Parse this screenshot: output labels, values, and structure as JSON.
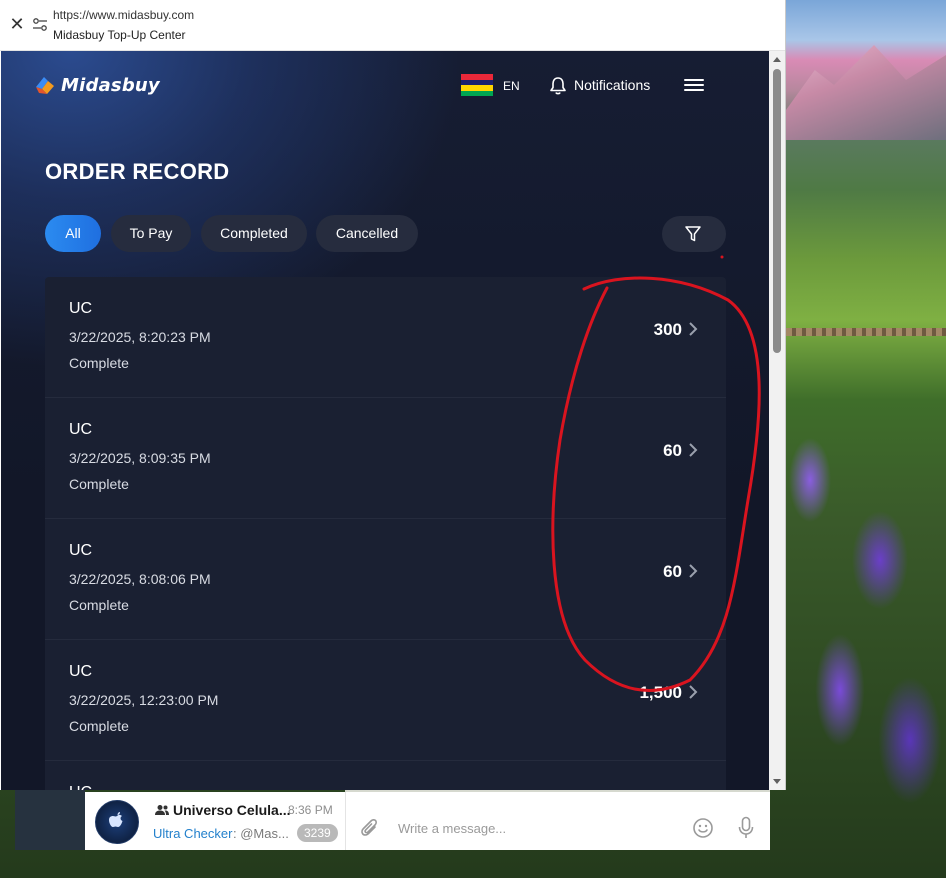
{
  "browser": {
    "url": "https://www.midasbuy.com",
    "title": "Midasbuy Top-Up Center"
  },
  "header": {
    "logo_text": "Midasbuy",
    "language": "EN",
    "notifications_label": "Notifications",
    "flag_colors": [
      "#ea2839",
      "#1a206d",
      "#ffd500",
      "#00a551"
    ]
  },
  "page": {
    "heading": "ORDER RECORD",
    "tabs": [
      {
        "label": "All",
        "active": true
      },
      {
        "label": "To Pay",
        "active": false
      },
      {
        "label": "Completed",
        "active": false
      },
      {
        "label": "Cancelled",
        "active": false
      }
    ]
  },
  "orders": [
    {
      "type": "UC",
      "date": "3/22/2025, 8:20:23 PM",
      "status": "Complete",
      "amount": "300"
    },
    {
      "type": "UC",
      "date": "3/22/2025, 8:09:35 PM",
      "status": "Complete",
      "amount": "60"
    },
    {
      "type": "UC",
      "date": "3/22/2025, 8:08:06 PM",
      "status": "Complete",
      "amount": "60"
    },
    {
      "type": "UC",
      "date": "3/22/2025, 12:23:00 PM",
      "status": "Complete",
      "amount": "1,500"
    },
    {
      "type": "UC",
      "date": "",
      "status": "",
      "amount": ""
    }
  ],
  "chat": {
    "name": "Universo Celula...",
    "time": "8:36 PM",
    "sender": "Ultra Checker",
    "preview": ": @Mas...",
    "unread": "3239",
    "composer_placeholder": "Write a message..."
  },
  "colors": {
    "accent": "#2b8bf0",
    "annotation": "#d9141f",
    "page_bg": "#121728"
  }
}
